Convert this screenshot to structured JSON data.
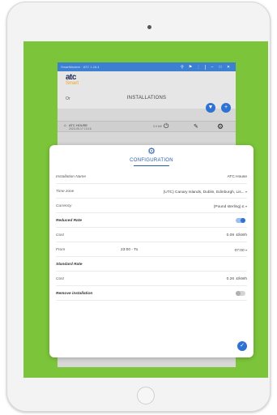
{
  "window": {
    "title": "SmartModern · ATC 1.16.4"
  },
  "app": {
    "logo_main": "atc",
    "logo_sub": "Smart",
    "or_label": "Or",
    "title": "INSTALLATIONS"
  },
  "device": {
    "name": "ATC HOUSE",
    "date": "2023-05-17 13:16",
    "status": "0.0 kW"
  },
  "dialog": {
    "title": "CONFIGURATION",
    "installation_name_label": "Installation Name",
    "installation_name_value": "ATC House",
    "timezone_label": "Time zone",
    "timezone_value": "(UTC) Canary Islands, Dublin, Edinburgh, Lis...",
    "currency_label": "Currency",
    "currency_value": "(Pound sterling) £",
    "reduced_rate_label": "Reduced Rate",
    "reduced_rate_on": true,
    "reduced_cost_label": "Cost",
    "reduced_cost_value": "0.09",
    "reduced_cost_unit": "£/kWh",
    "from_label": "From",
    "from_value": "23:00 - To",
    "to_value": "07:00",
    "standard_rate_label": "Standard Rate",
    "standard_cost_label": "Cost",
    "standard_cost_value": "0.26",
    "standard_cost_unit": "£/kWh",
    "remove_label": "Remove installation",
    "remove_on": false
  },
  "icons": {
    "power": "power-icon",
    "settings": "gear-icon",
    "edit": "edit-icon",
    "check": "check-icon"
  },
  "colors": {
    "accent": "#2f72d6",
    "background_green": "#7cc53a",
    "titlebar": "#3d7fd1"
  }
}
